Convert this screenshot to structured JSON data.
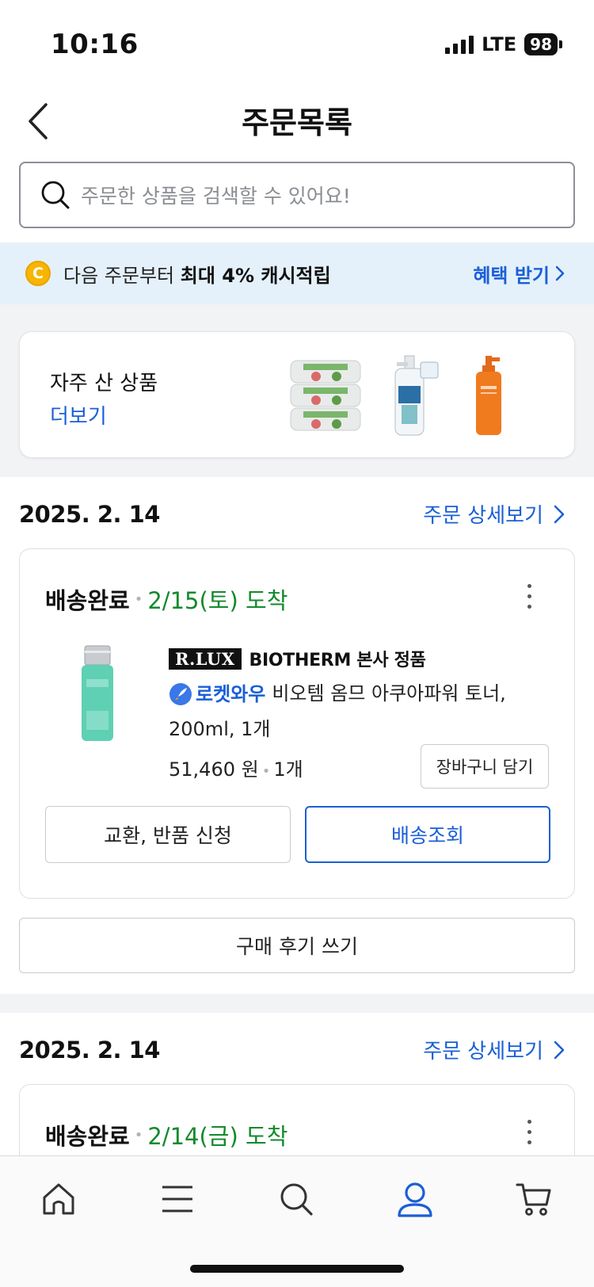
{
  "status_bar": {
    "time": "10:16",
    "network": "LTE",
    "battery": "98"
  },
  "header": {
    "title": "주문목록"
  },
  "search": {
    "placeholder": "주문한 상품을 검색할 수 있어요!"
  },
  "cash_banner": {
    "coin_letter": "C",
    "text_prefix": "다음 주문부터 ",
    "text_bold": "최대 4% 캐시적립",
    "link_label": "혜택 받기"
  },
  "frequent": {
    "title": "자주 산 상품",
    "more_label": "더보기",
    "products": [
      "wrap-roll-pack",
      "shampoo-bottle",
      "orange-pump-bottle"
    ]
  },
  "orders": [
    {
      "date": "2025. 2. 14",
      "detail_label": "주문 상세보기",
      "status": "배송완료",
      "arrival": "2/15(토) 도착",
      "brand_badge": "R.LUX",
      "brand_text": "BIOTHERM 본사 정품",
      "rocket_label": "로켓와우",
      "product_name": "비오템 옴므 아쿠아파워 토너, 200ml, 1개",
      "price": "51,460 원",
      "quantity": "1개",
      "cart_label": "장바구니 담기",
      "return_label": "교환, 반품 신청",
      "track_label": "배송조회",
      "review_label": "구매 후기 쓰기"
    },
    {
      "date": "2025. 2. 14",
      "detail_label": "주문 상세보기",
      "status": "배송완료",
      "arrival": "2/14(금) 도착"
    }
  ],
  "tab_bar": {
    "items": [
      "home-icon",
      "menu-icon",
      "search-icon",
      "user-icon",
      "cart-icon"
    ],
    "active": "user-icon"
  },
  "colors": {
    "accent": "#1a5fd6",
    "arrival_green": "#128a2c",
    "banner_bg": "#e4f1fb",
    "coin": "#f7b500"
  }
}
